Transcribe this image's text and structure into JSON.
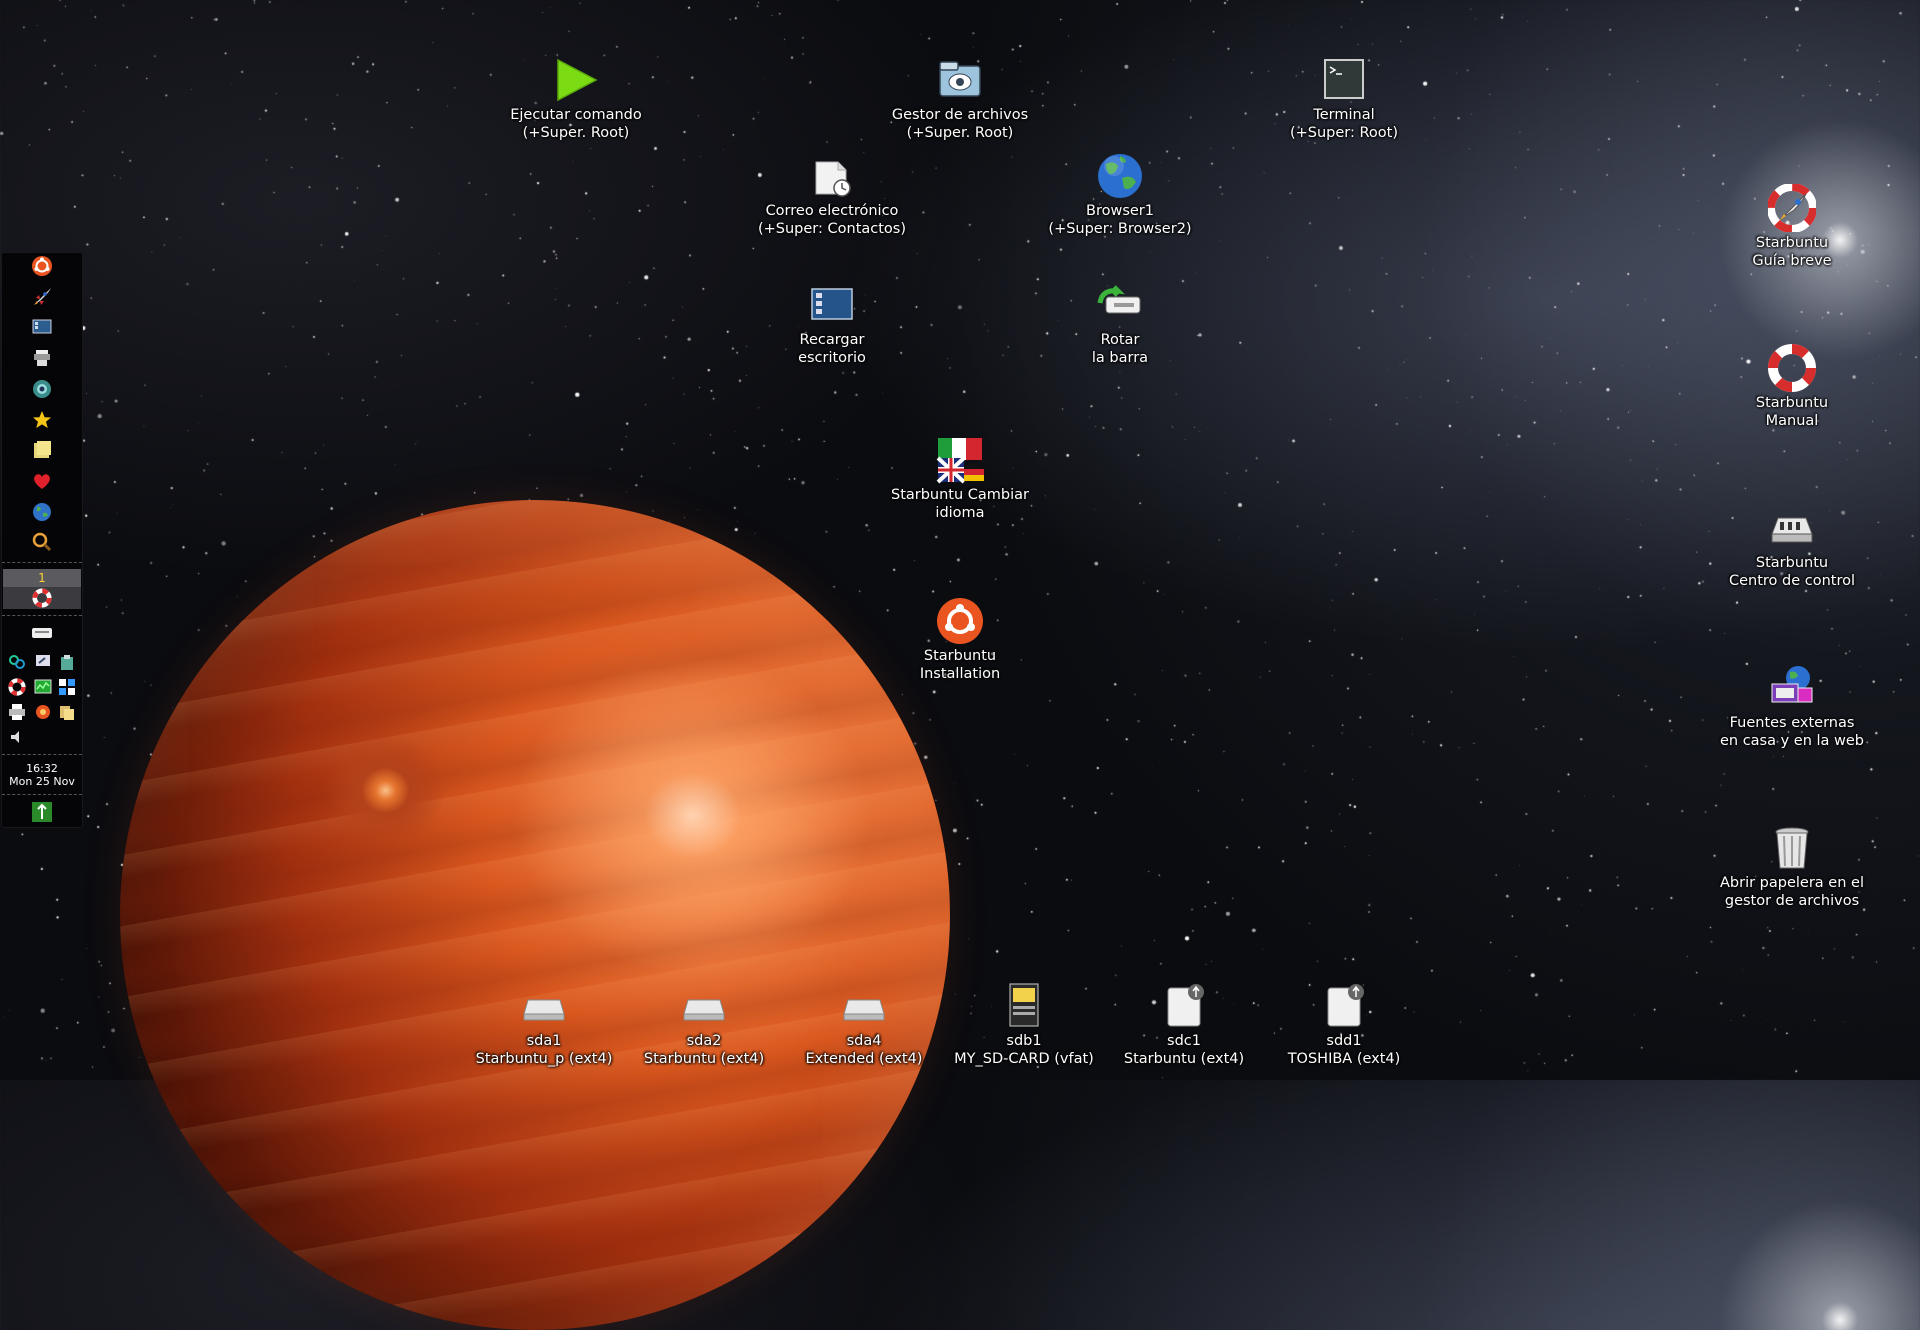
{
  "desktop": {
    "icons": [
      {
        "id": "ejecutar",
        "line1": "Ejecutar comando",
        "line2": "(+Super. Root)",
        "icon": "play-icon"
      },
      {
        "id": "gestor",
        "line1": "Gestor de archivos",
        "line2": "(+Super. Root)",
        "icon": "file-manager-icon"
      },
      {
        "id": "terminal",
        "line1": "Terminal",
        "line2": "(+Super: Root)",
        "icon": "terminal-icon"
      },
      {
        "id": "correo",
        "line1": "Correo electrónico",
        "line2": "(+Super: Contactos)",
        "icon": "email-icon"
      },
      {
        "id": "browser",
        "line1": "Browser1",
        "line2": "(+Super: Browser2)",
        "icon": "globe-icon"
      },
      {
        "id": "recargar",
        "line1": "Recargar",
        "line2": "escritorio",
        "icon": "desktop-reload-icon"
      },
      {
        "id": "rotar",
        "line1": "Rotar",
        "line2": "la barra",
        "icon": "rotate-panel-icon"
      },
      {
        "id": "idioma",
        "line1": "Starbuntu Cambiar",
        "line2": "idioma",
        "icon": "language-flags-icon"
      },
      {
        "id": "install",
        "line1": "Starbuntu",
        "line2": "Installation",
        "icon": "installer-icon"
      },
      {
        "id": "guia",
        "line1": "Starbuntu",
        "line2": "Guía breve",
        "icon": "rocket-icon"
      },
      {
        "id": "manual",
        "line1": "Starbuntu",
        "line2": "Manual",
        "icon": "lifebuoy-icon"
      },
      {
        "id": "control",
        "line1": "Starbuntu",
        "line2": "Centro de control",
        "icon": "control-center-icon"
      },
      {
        "id": "fuentes",
        "line1": "Fuentes externas",
        "line2": "en casa y en la web",
        "icon": "network-sources-icon"
      },
      {
        "id": "papelera",
        "line1": "Abrir papelera en el",
        "line2": "gestor de archivos",
        "icon": "trash-icon"
      }
    ],
    "drives": [
      {
        "id": "sda1",
        "line1": "sda1",
        "line2": "Starbuntu_p (ext4)",
        "icon": "hard-drive-icon"
      },
      {
        "id": "sda2",
        "line1": "sda2",
        "line2": "Starbuntu (ext4)",
        "icon": "hard-drive-icon"
      },
      {
        "id": "sda4",
        "line1": "sda4",
        "line2": "Extended (ext4)",
        "icon": "hard-drive-icon"
      },
      {
        "id": "sdb1",
        "line1": "sdb1",
        "line2": "MY_SD-CARD (vfat)",
        "icon": "sd-card-icon"
      },
      {
        "id": "sdc1",
        "line1": "sdc1",
        "line2": "Starbuntu (ext4)",
        "icon": "usb-drive-icon"
      },
      {
        "id": "sdd1",
        "line1": "sdd1",
        "line2": "TOSHIBA (ext4)",
        "icon": "usb-drive-icon"
      }
    ]
  },
  "panel": {
    "launchers": [
      "ubuntu-logo-icon",
      "rocket-icon",
      "desktop-icon",
      "printer-stack-icon",
      "camera-icon",
      "star-icon",
      "notes-icon",
      "heart-icon",
      "globe-icon",
      "search-icon"
    ],
    "workspace_number": "1",
    "clock_time": "16:32",
    "clock_date": "Mon 25 Nov",
    "colors": {
      "panel_bg": "#050507",
      "workspace_num": "#ffce30"
    }
  }
}
